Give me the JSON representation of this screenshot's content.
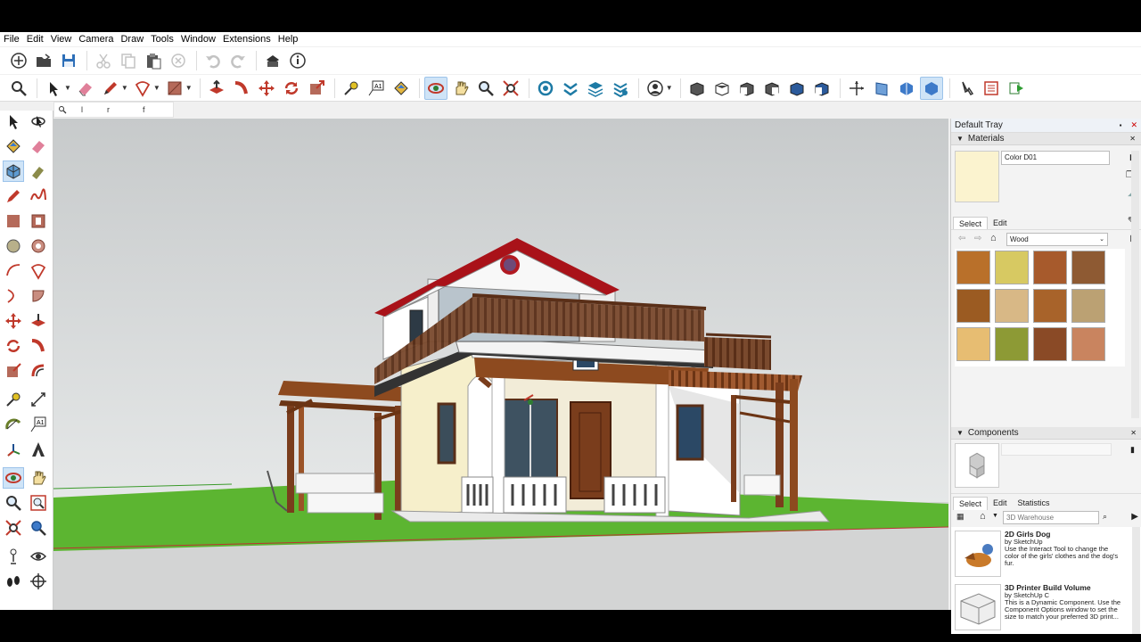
{
  "menu": [
    "File",
    "Edit",
    "View",
    "Camera",
    "Draw",
    "Tools",
    "Window",
    "Extensions",
    "Help"
  ],
  "measurements": {
    "f1": "l",
    "f2": "r",
    "f3": "f"
  },
  "tray": {
    "title": "Default Tray",
    "materials": {
      "header": "Materials",
      "current_name": "Color D01",
      "current_color": "#fbf3cf",
      "tabs": [
        "Select",
        "Edit"
      ],
      "library": "Wood",
      "swatches": [
        "#b9702a",
        "#d7c962",
        "#a75a2c",
        "#8e5a33",
        "#9b5b22",
        "#d8b886",
        "#a8632a",
        "#bba173",
        "#e7bd72",
        "#8d9a35",
        "#8a4a26",
        "#c9845f"
      ]
    },
    "components": {
      "header": "Components",
      "tabs": [
        "Select",
        "Edit",
        "Statistics"
      ],
      "search_placeholder": "3D Warehouse",
      "items": [
        {
          "name": "2D Girls Dog",
          "by": "by SketchUp",
          "desc": "Use the Interact Tool to change the color of the girls' clothes and the dog's fur."
        },
        {
          "name": "3D Printer Build Volume",
          "by": "by SketchUp C",
          "desc": "This is a Dynamic Component. Use the Component Options window to set the size to match your preferred 3D print..."
        }
      ]
    }
  },
  "colors": {
    "accent": "#cfe4f7",
    "grass": "#5cb531",
    "roof": "#b0121c",
    "wood": "#7a3d1c",
    "sky_top": "#c9cccd",
    "ground": "#d4d4d4"
  }
}
